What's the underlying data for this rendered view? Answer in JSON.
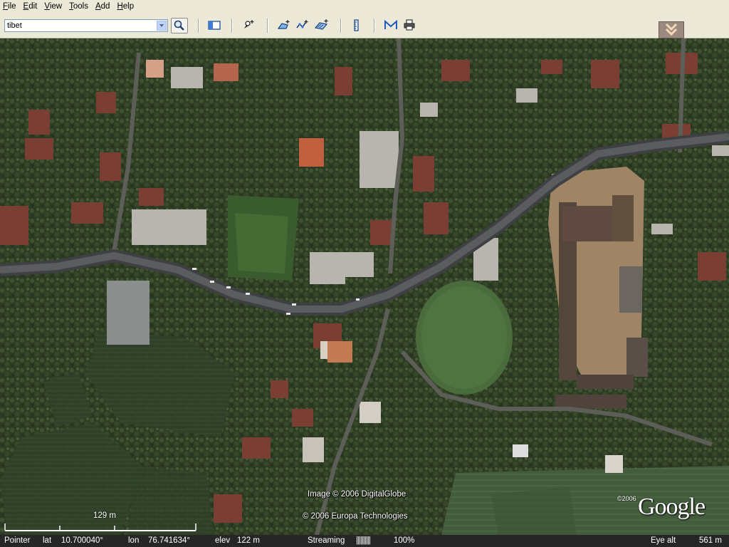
{
  "menu": {
    "items": [
      {
        "name": "file",
        "ul": "F",
        "rest": "ile"
      },
      {
        "name": "edit",
        "ul": "E",
        "rest": "dit"
      },
      {
        "name": "view",
        "ul": "V",
        "rest": "iew"
      },
      {
        "name": "tools",
        "ul": "T",
        "rest": "ools"
      },
      {
        "name": "add",
        "ul": "A",
        "rest": "dd"
      },
      {
        "name": "help",
        "ul": "H",
        "rest": "elp"
      }
    ]
  },
  "toolbar": {
    "search_value": "tibet",
    "icons": [
      "search-icon",
      "sidebar-icon",
      "placemark-icon",
      "polygon-icon",
      "path-icon",
      "overlay-icon",
      "ruler-icon",
      "email-icon",
      "print-icon"
    ]
  },
  "map": {
    "credit_image": "Image © 2006 DigitalGlobe",
    "credit_data": "© 2006 Europa Technologies",
    "logo_year": "©2006",
    "logo": "Google",
    "scale_label": "129 m"
  },
  "status": {
    "pointer": "Pointer",
    "lat_label": "lat",
    "lat_value": "10.700040°",
    "lon_label": "lon",
    "lon_value": "76.741634°",
    "elev_label": "elev",
    "elev_value": "122 m",
    "streaming_label": "Streaming",
    "streaming_bar": "||||||||||",
    "streaming_percent": "100%",
    "eye_label": "Eye alt",
    "eye_value": "561 m"
  }
}
